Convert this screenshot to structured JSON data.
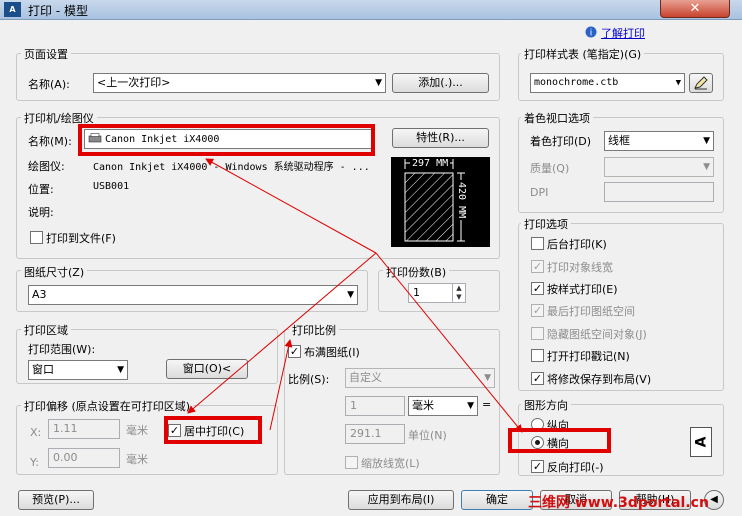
{
  "window": {
    "title": "打印 - 模型",
    "close_label": "✕",
    "app_icon": "plot-icon"
  },
  "help_link": "了解打印",
  "page_setup": {
    "label": "页面设置",
    "name_label": "名称(A):",
    "name_value": "<上一次打印>",
    "add_button": "添加(.)..."
  },
  "printer": {
    "label": "打印机/绘图仪",
    "name_label": "名称(M):",
    "name_value": "Canon Inkjet iX4000",
    "properties_button": "特性(R)...",
    "plotter_label": "绘图仪:",
    "plotter_value": "Canon Inkjet iX4000 - Windows 系统驱动程序 - ...",
    "location_label": "位置:",
    "location_value": "USB001",
    "description_label": "说明:",
    "print_to_file_label": "打印到文件(F)",
    "preview": {
      "width_label": "297 MM",
      "height_label": "420 MM"
    }
  },
  "paper_size": {
    "label": "图纸尺寸(Z)",
    "value": "A3"
  },
  "copies": {
    "label": "打印份数(B)",
    "value": "1"
  },
  "plot_area": {
    "label": "打印区域",
    "range_label": "打印范围(W):",
    "range_value": "窗口",
    "window_button": "窗口(O)<"
  },
  "plot_scale": {
    "label": "打印比例",
    "fit_label": "布满图纸(I)",
    "scale_label": "比例(S):",
    "scale_value": "自定义",
    "value1": "1",
    "unit_value": "毫米",
    "equals": "=",
    "value2": "291.1",
    "unit_label": "单位(N)",
    "lineweight_label": "缩放线宽(L)"
  },
  "plot_offset": {
    "label": "打印偏移 (原点设置在可打印区域)",
    "x_label": "X:",
    "x_value": "1.11",
    "x_unit": "毫米",
    "center_label": "居中打印(C)",
    "y_label": "Y:",
    "y_value": "0.00",
    "y_unit": "毫米"
  },
  "style_table": {
    "label": "打印样式表 (笔指定)(G)",
    "value": "monochrome.ctb"
  },
  "shaded_viewport": {
    "label": "着色视口选项",
    "shade_label": "着色打印(D)",
    "shade_value": "线框",
    "quality_label": "质量(Q)",
    "dpi_label": "DPI"
  },
  "plot_options": {
    "label": "打印选项",
    "items": [
      {
        "label": "后台打印(K)",
        "checked": false,
        "disabled": false
      },
      {
        "label": "打印对象线宽",
        "checked": true,
        "disabled": true
      },
      {
        "label": "按样式打印(E)",
        "checked": true,
        "disabled": false
      },
      {
        "label": "最后打印图纸空间",
        "checked": true,
        "disabled": true
      },
      {
        "label": "隐藏图纸空间对象(J)",
        "checked": false,
        "disabled": true
      },
      {
        "label": "打开打印戳记(N)",
        "checked": false,
        "disabled": false
      },
      {
        "label": "将修改保存到布局(V)",
        "checked": true,
        "disabled": false
      }
    ]
  },
  "orientation": {
    "label": "图形方向",
    "portrait_label": "纵向",
    "landscape_label": "横向",
    "reverse_label": "反向打印(-)",
    "icon_letter": "A"
  },
  "buttons": {
    "preview": "预览(P)...",
    "apply": "应用到布局(I)",
    "ok": "确定",
    "cancel": "取消",
    "help": "帮助(H)"
  },
  "watermark": "三维网 www.3dportal.cn",
  "colors": {
    "annotation_red": "#e00000",
    "watermark_red": "#d01010"
  }
}
